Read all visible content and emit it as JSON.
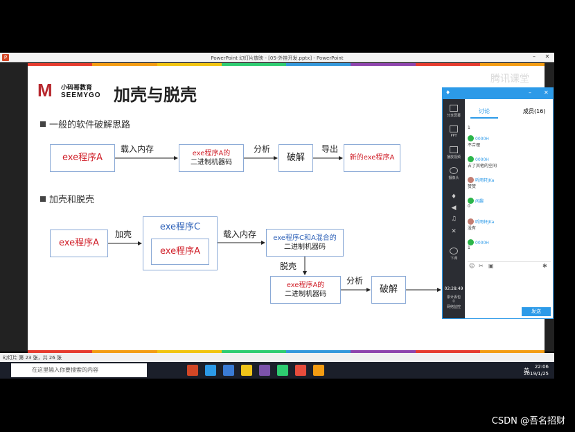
{
  "window": {
    "title": "PowerPoint 幻灯片放映 - [05-外挂开发.pptx] - PowerPoint",
    "app_icon": "P"
  },
  "slide": {
    "logo_cn": "小码哥教育",
    "logo_en": "SEEMYGO",
    "title": "加壳与脱壳",
    "section1": "一般的软件破解思路",
    "section2": "加壳和脱壳",
    "flow1": {
      "box1": "exe程序A",
      "edge1": "载入内存",
      "box2_line1": "exe程序A的",
      "box2_line2": "二进制机器码",
      "edge2": "分析",
      "box3": "破解",
      "edge3": "导出",
      "box4": "新的exe程序A"
    },
    "flow2": {
      "box1": "exe程序A",
      "edge1": "加壳",
      "outer_label": "exe程序C",
      "inner_box": "exe程序A",
      "edge2": "载入内存",
      "box3_line1": "exe程序C和A混合的",
      "box3_line2": "二进制机器码",
      "edge3": "脱壳",
      "box4_line1": "exe程序A的",
      "box4_line2": "二进制机器码",
      "edge4": "分析",
      "box5": "破解"
    }
  },
  "statusbar": {
    "slide_info": "幻灯片 第 23 张，共 26 张"
  },
  "taskbar": {
    "search_placeholder": "在这里输入你要搜索的内容",
    "time": "22:06",
    "date": "2019/1/25",
    "ime": "英"
  },
  "chat": {
    "tab_discuss": "讨论",
    "tab_members": "成员(16)",
    "side": {
      "share_screen": "分享屏幕",
      "ppt": "PPT",
      "play_video": "播放视频",
      "camera": "摄像头",
      "class_end": "下课",
      "timer": "02:28:49",
      "stats1": "累计丢包",
      "stats2": "0",
      "stats3": "网络监控"
    },
    "messages": [
      {
        "text": "1"
      },
      {
        "name": "0000H",
        "text": "不合理"
      },
      {
        "name": "0000H",
        "text": "占了其他的空间"
      },
      {
        "name": "听雨轩JKa",
        "text": "赞赞"
      },
      {
        "name": "闲趣",
        "text": "0"
      },
      {
        "name": "听雨轩JKa",
        "text": "没有"
      },
      {
        "name": "0000H",
        "text": "1"
      }
    ],
    "send": "发送"
  },
  "watermark": "腾讯课堂",
  "credit": "CSDN @吾名招财",
  "colors": {
    "accent": "#2c9ae8",
    "red_text": "#d0202a",
    "blue_text": "#2f62b8"
  }
}
